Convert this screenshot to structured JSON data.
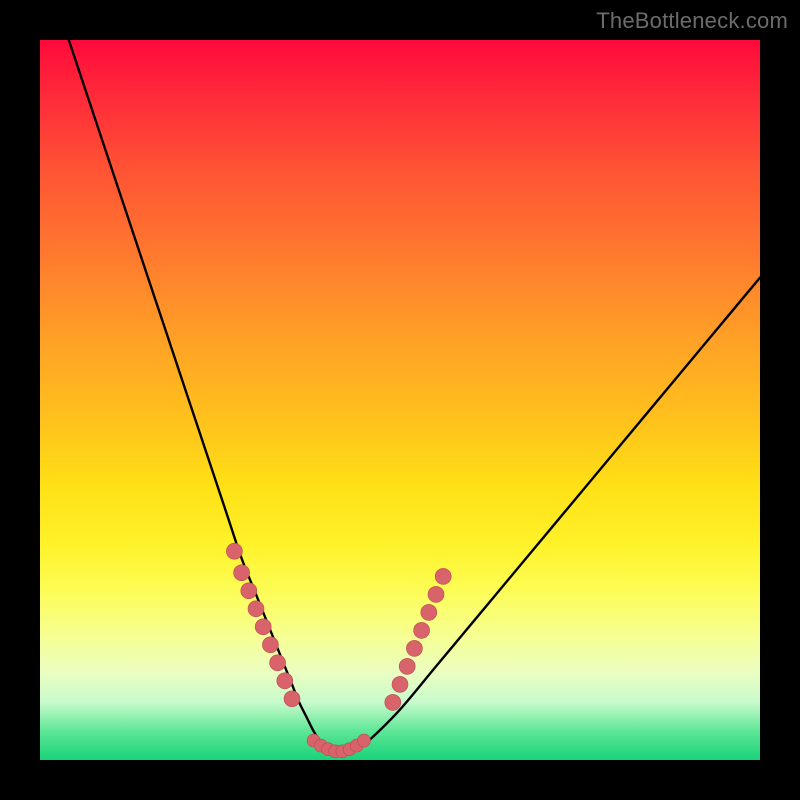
{
  "attribution": "TheBottleneck.com",
  "colors": {
    "frame_bg": "#000000",
    "gradient_top": "#ff0a3a",
    "gradient_bottom": "#18d37a",
    "curve_stroke": "#000000",
    "marker_fill": "#d9636a",
    "marker_stroke": "#b94a50"
  },
  "chart_data": {
    "type": "line",
    "title": "",
    "xlabel": "",
    "ylabel": "",
    "xlim": [
      0,
      100
    ],
    "ylim": [
      0,
      100
    ],
    "grid": false,
    "legend": false,
    "series": [
      {
        "name": "curve",
        "x": [
          4,
          6,
          8,
          10,
          12,
          14,
          16,
          18,
          20,
          22,
          24,
          26,
          28,
          30,
          32,
          33,
          34,
          35,
          36,
          37,
          38,
          39,
          40,
          41,
          42,
          43,
          44,
          46,
          50,
          55,
          60,
          65,
          70,
          75,
          80,
          85,
          90,
          95,
          100
        ],
        "y": [
          100,
          94,
          88,
          82,
          76,
          70,
          64,
          58,
          52,
          46,
          40,
          34,
          28,
          23,
          18,
          15.5,
          13,
          10.5,
          8,
          6,
          4,
          2.5,
          1.5,
          1,
          1,
          1,
          1.5,
          3,
          7,
          13,
          19,
          25,
          31,
          37,
          43,
          49,
          55,
          61,
          67
        ]
      }
    ],
    "markers": {
      "left_cluster": [
        {
          "x": 27,
          "y": 29
        },
        {
          "x": 28,
          "y": 26
        },
        {
          "x": 29,
          "y": 23.5
        },
        {
          "x": 30,
          "y": 21
        },
        {
          "x": 31,
          "y": 18.5
        },
        {
          "x": 32,
          "y": 16
        },
        {
          "x": 33,
          "y": 13.5
        },
        {
          "x": 34,
          "y": 11
        },
        {
          "x": 35,
          "y": 8.5
        }
      ],
      "bottom_cluster": [
        {
          "x": 38,
          "y": 2.7
        },
        {
          "x": 39,
          "y": 2
        },
        {
          "x": 40,
          "y": 1.5
        },
        {
          "x": 41,
          "y": 1.2
        },
        {
          "x": 42,
          "y": 1.2
        },
        {
          "x": 43,
          "y": 1.5
        },
        {
          "x": 44,
          "y": 2
        },
        {
          "x": 45,
          "y": 2.7
        }
      ],
      "right_cluster": [
        {
          "x": 49,
          "y": 8
        },
        {
          "x": 50,
          "y": 10.5
        },
        {
          "x": 51,
          "y": 13
        },
        {
          "x": 52,
          "y": 15.5
        },
        {
          "x": 53,
          "y": 18
        },
        {
          "x": 54,
          "y": 20.5
        },
        {
          "x": 55,
          "y": 23
        },
        {
          "x": 56,
          "y": 25.5
        }
      ]
    }
  }
}
